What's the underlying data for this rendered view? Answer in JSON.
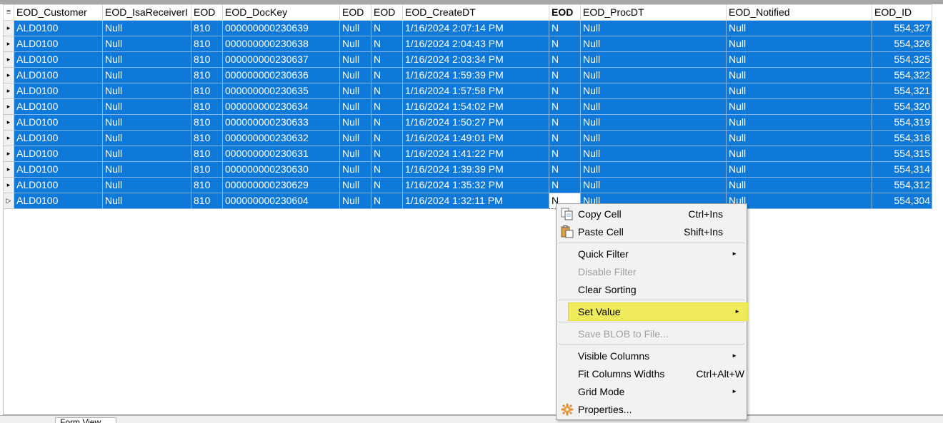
{
  "grid": {
    "headers": [
      "EOD_Customer",
      "EOD_IsaReceiverI",
      "EOD",
      "EOD_DocKey",
      "EOD",
      "EOD",
      "EOD_CreateDT",
      "EOD",
      "EOD_ProcDT",
      "EOD_Notified",
      "EOD_ID"
    ],
    "rows": [
      [
        "ALD0100",
        "Null",
        "810",
        "000000000230639",
        "Null",
        "N",
        "1/16/2024 2:07:14 PM",
        "N",
        "Null",
        "Null",
        "554,327"
      ],
      [
        "ALD0100",
        "Null",
        "810",
        "000000000230638",
        "Null",
        "N",
        "1/16/2024 2:04:43 PM",
        "N",
        "Null",
        "Null",
        "554,326"
      ],
      [
        "ALD0100",
        "Null",
        "810",
        "000000000230637",
        "Null",
        "N",
        "1/16/2024 2:03:34 PM",
        "N",
        "Null",
        "Null",
        "554,325"
      ],
      [
        "ALD0100",
        "Null",
        "810",
        "000000000230636",
        "Null",
        "N",
        "1/16/2024 1:59:39 PM",
        "N",
        "Null",
        "Null",
        "554,322"
      ],
      [
        "ALD0100",
        "Null",
        "810",
        "000000000230635",
        "Null",
        "N",
        "1/16/2024 1:57:58 PM",
        "N",
        "Null",
        "Null",
        "554,321"
      ],
      [
        "ALD0100",
        "Null",
        "810",
        "000000000230634",
        "Null",
        "N",
        "1/16/2024 1:54:02 PM",
        "N",
        "Null",
        "Null",
        "554,320"
      ],
      [
        "ALD0100",
        "Null",
        "810",
        "000000000230633",
        "Null",
        "N",
        "1/16/2024 1:50:27 PM",
        "N",
        "Null",
        "Null",
        "554,319"
      ],
      [
        "ALD0100",
        "Null",
        "810",
        "000000000230632",
        "Null",
        "N",
        "1/16/2024 1:49:01 PM",
        "N",
        "Null",
        "Null",
        "554,318"
      ],
      [
        "ALD0100",
        "Null",
        "810",
        "000000000230631",
        "Null",
        "N",
        "1/16/2024 1:41:22 PM",
        "N",
        "Null",
        "Null",
        "554,315"
      ],
      [
        "ALD0100",
        "Null",
        "810",
        "000000000230630",
        "Null",
        "N",
        "1/16/2024 1:39:39 PM",
        "N",
        "Null",
        "Null",
        "554,314"
      ],
      [
        "ALD0100",
        "Null",
        "810",
        "000000000230629",
        "Null",
        "N",
        "1/16/2024 1:35:32 PM",
        "N",
        "Null",
        "Null",
        "554,312"
      ],
      [
        "ALD0100",
        "Null",
        "810",
        "000000000230604",
        "Null",
        "N",
        "1/16/2024 1:32:11 PM",
        "N",
        "Null",
        "Null",
        "554,304"
      ]
    ],
    "selection_color": "#0f79d9"
  },
  "context_menu": {
    "copy_cell": {
      "label": "Copy Cell",
      "shortcut": "Ctrl+Ins"
    },
    "paste_cell": {
      "label": "Paste Cell",
      "shortcut": "Shift+Ins"
    },
    "quick_filter": {
      "label": "Quick Filter"
    },
    "disable_filter": {
      "label": "Disable Filter"
    },
    "clear_sorting": {
      "label": "Clear Sorting"
    },
    "set_value": {
      "label": "Set Value"
    },
    "save_blob": {
      "label": "Save BLOB to File..."
    },
    "visible_columns": {
      "label": "Visible Columns"
    },
    "fit_columns": {
      "label": "Fit Columns Widths",
      "shortcut": "Ctrl+Alt+W"
    },
    "grid_mode": {
      "label": "Grid Mode"
    },
    "properties": {
      "label": "Properties..."
    },
    "highlight_color": "#efea5a"
  },
  "bottom_tab": {
    "label": "Form View"
  }
}
